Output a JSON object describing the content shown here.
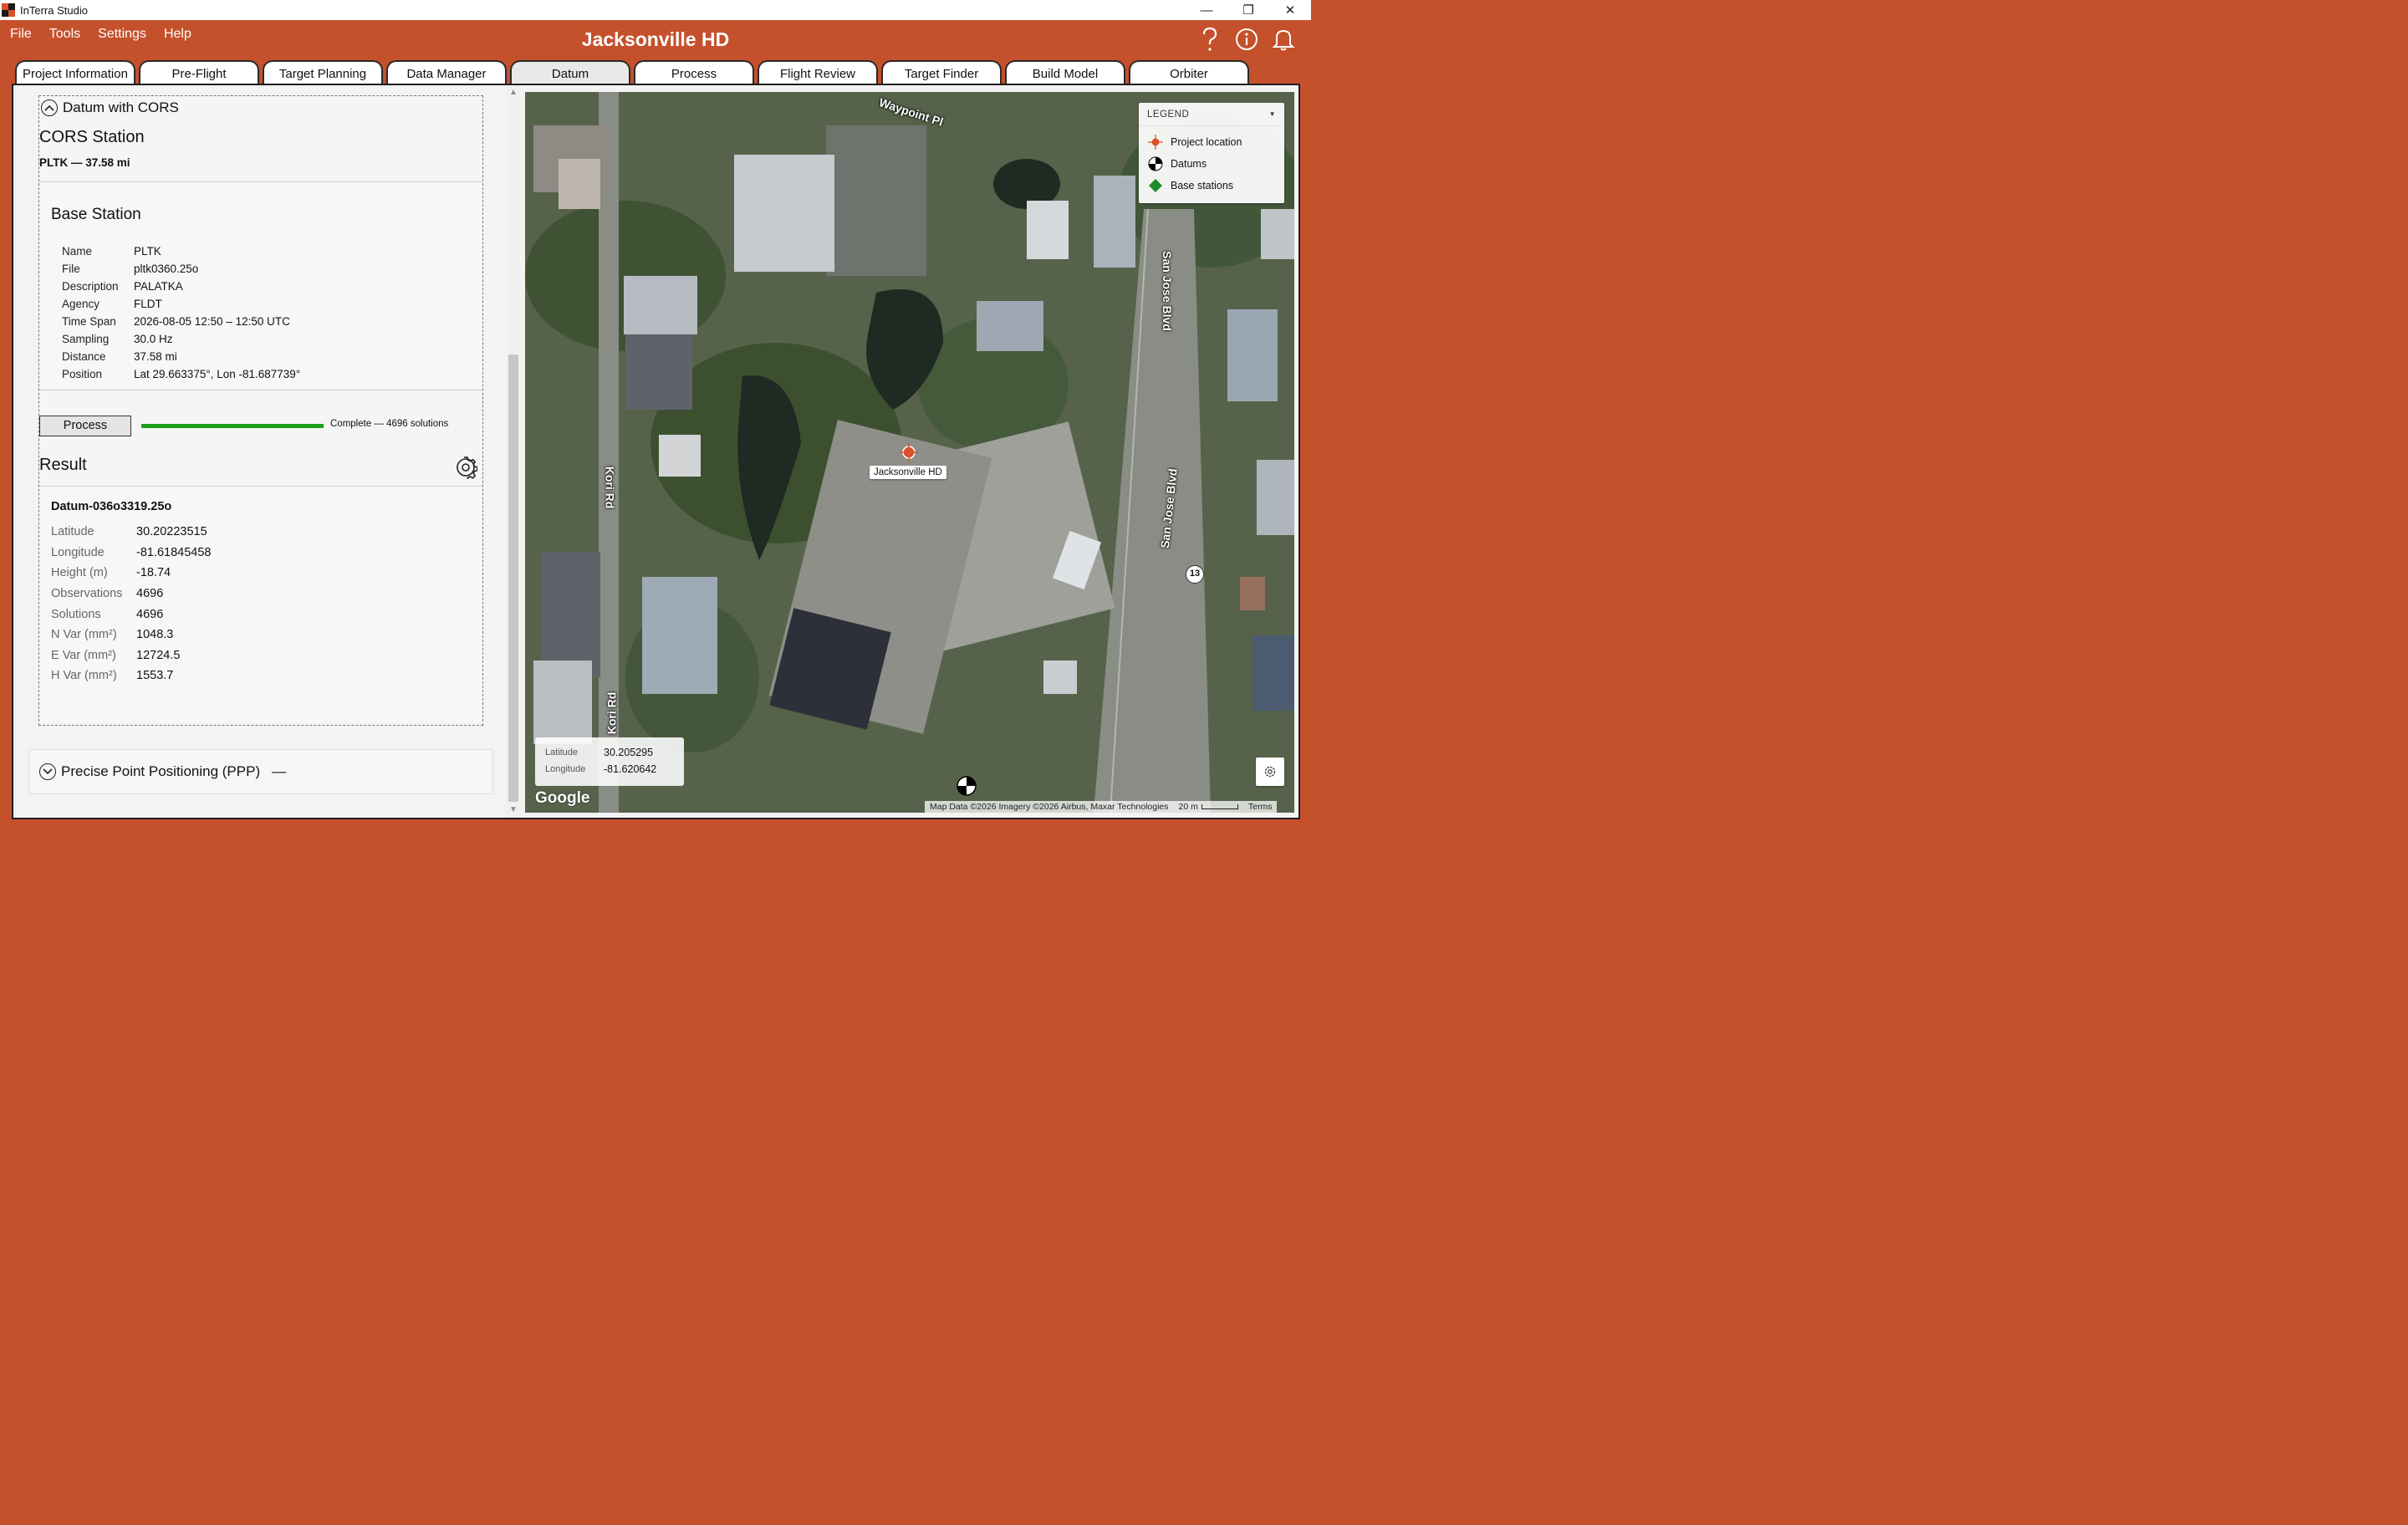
{
  "window": {
    "app_title": "InTerra Studio",
    "minimize": "—",
    "restore": "❐",
    "close": "✕"
  },
  "menu": {
    "items": [
      "File",
      "Tools",
      "Settings",
      "Help"
    ]
  },
  "header": {
    "project_title": "Jacksonville HD",
    "icons": [
      "question-icon",
      "info-icon",
      "bell-icon"
    ]
  },
  "tabs": [
    {
      "label": "Project Information"
    },
    {
      "label": "Pre-Flight"
    },
    {
      "label": "Target Planning"
    },
    {
      "label": "Data Manager"
    },
    {
      "label": "Datum",
      "active": true
    },
    {
      "label": "Process"
    },
    {
      "label": "Flight Review"
    },
    {
      "label": "Target Finder"
    },
    {
      "label": "Build Model"
    },
    {
      "label": "Orbiter"
    }
  ],
  "datum_section": {
    "title": "Datum with CORS",
    "cors_title": "CORS Station",
    "cors_summary": "PLTK — 37.58 mi",
    "base_station": {
      "title": "Base Station",
      "fields": [
        {
          "key": "Name",
          "value": "PLTK"
        },
        {
          "key": "File",
          "value": "pltk0360.25o"
        },
        {
          "key": "Description",
          "value": "PALATKA"
        },
        {
          "key": "Agency",
          "value": "FLDT"
        },
        {
          "key": "Time Span",
          "value": "2026-08-05 12:50 – 12:50 UTC"
        },
        {
          "key": "Sampling",
          "value": "30.0 Hz"
        },
        {
          "key": "Distance",
          "value": "37.58 mi"
        },
        {
          "key": "Position",
          "value": "Lat 29.663375°, Lon -81.687739°"
        }
      ]
    },
    "process_button": "Process",
    "progress_fraction": 1.0,
    "progress_text": "Complete — 4696 solutions",
    "result": {
      "title": "Result",
      "datum_name": "Datum-036o3319.25o",
      "fields": [
        {
          "key": "Latitude",
          "value": "30.20223515"
        },
        {
          "key": "Longitude",
          "value": "-81.61845458"
        },
        {
          "key": "Height (m)",
          "value": "-18.74"
        },
        {
          "key": "Observations",
          "value": "4696"
        },
        {
          "key": "Solutions",
          "value": "4696"
        },
        {
          "key": "N Var (mm²)",
          "value": "1048.3"
        },
        {
          "key": "E Var (mm²)",
          "value": "12724.5"
        },
        {
          "key": "H Var (mm²)",
          "value": "1553.7"
        }
      ]
    }
  },
  "ppp_section": {
    "title": "Precise Point Positioning (PPP)",
    "status": "—"
  },
  "map": {
    "legend": {
      "title": "LEGEND",
      "items": [
        {
          "label": "Project location",
          "icon": "project-location-icon",
          "color": "#d9502b"
        },
        {
          "label": "Datums",
          "icon": "datum-icon",
          "color": "#000000"
        },
        {
          "label": "Base stations",
          "icon": "base-station-icon",
          "color": "#1e8a2a"
        }
      ]
    },
    "project_marker_label": "Jacksonville HD",
    "streets": {
      "waypoint": "Waypoint Pl",
      "san_jose_1": "San Jose Blvd",
      "san_jose_2": "San Jose Blvd",
      "kori_1": "Kori Rd",
      "kori_2": "Kori Rd",
      "route": "13"
    },
    "cursor": {
      "lat_label": "Latitude",
      "lat_value": "30.205295",
      "lon_label": "Longitude",
      "lon_value": "-81.620642"
    },
    "google_logo": "Google",
    "attribution": "Map Data ©2026 Imagery ©2026 Airbus, Maxar Technologies",
    "scale_label": "20 m",
    "terms": "Terms"
  },
  "colors": {
    "brand": "#c5502c",
    "progress": "#1ba01b",
    "base_station": "#1e8a2a",
    "project": "#d9502b"
  }
}
